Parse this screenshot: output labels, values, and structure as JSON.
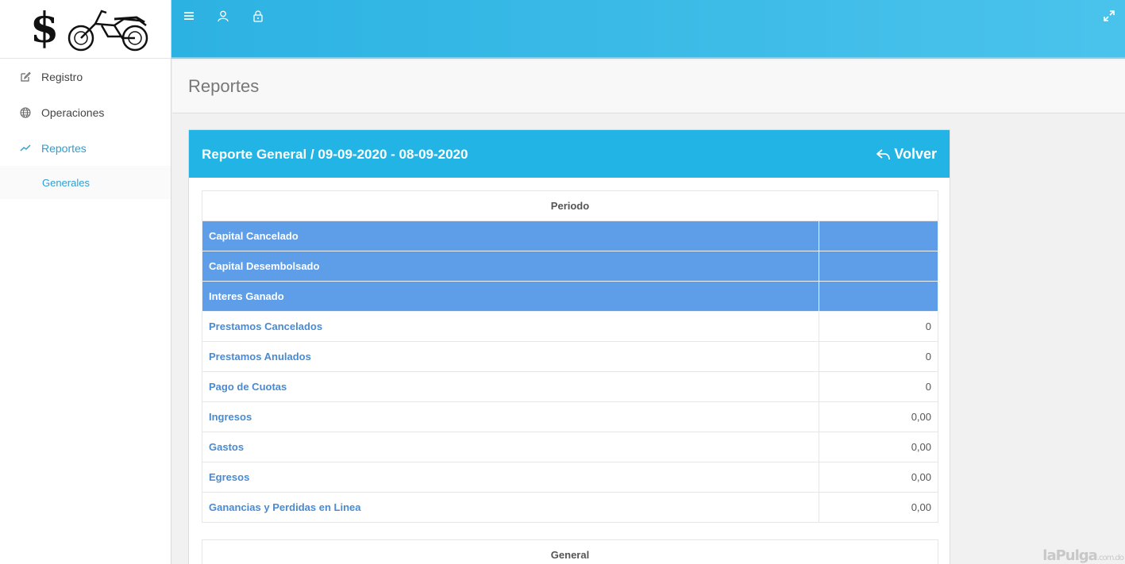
{
  "logo": {
    "dollar": "$"
  },
  "sidebar": {
    "items": [
      {
        "label": "Registro",
        "icon": "edit-icon"
      },
      {
        "label": "Operaciones",
        "icon": "globe-icon"
      },
      {
        "label": "Reportes",
        "icon": "trend-icon"
      }
    ],
    "subitems": [
      {
        "label": "Generales"
      }
    ]
  },
  "topbar": {
    "icons": [
      "menu-icon",
      "user-icon",
      "lock-icon",
      "expand-icon"
    ]
  },
  "page": {
    "title": "Reportes"
  },
  "panel": {
    "title": "Reporte General / 09-09-2020 - 08-09-2020",
    "back_label": "Volver"
  },
  "table": {
    "header": "Periodo",
    "highlight_rows": [
      {
        "label": "Capital Cancelado",
        "value": ""
      },
      {
        "label": "Capital Desembolsado",
        "value": ""
      },
      {
        "label": "Interes Ganado",
        "value": ""
      }
    ],
    "rows": [
      {
        "label": "Prestamos Cancelados",
        "value": "0"
      },
      {
        "label": "Prestamos Anulados",
        "value": "0"
      },
      {
        "label": "Pago de Cuotas",
        "value": "0"
      },
      {
        "label": "Ingresos",
        "value": "0,00"
      },
      {
        "label": "Gastos",
        "value": "0,00"
      },
      {
        "label": "Egresos",
        "value": "0,00"
      },
      {
        "label": "Ganancias y Perdidas en Linea",
        "value": "0,00"
      }
    ]
  },
  "table2": {
    "header": "General"
  },
  "watermark": {
    "brand": "laPulga",
    "domain": ".com.do"
  },
  "colors": {
    "topbar": "#2cb2e2",
    "highlight": "#5e9de8",
    "link": "#4a8ad0",
    "active": "#2a9fd6"
  }
}
